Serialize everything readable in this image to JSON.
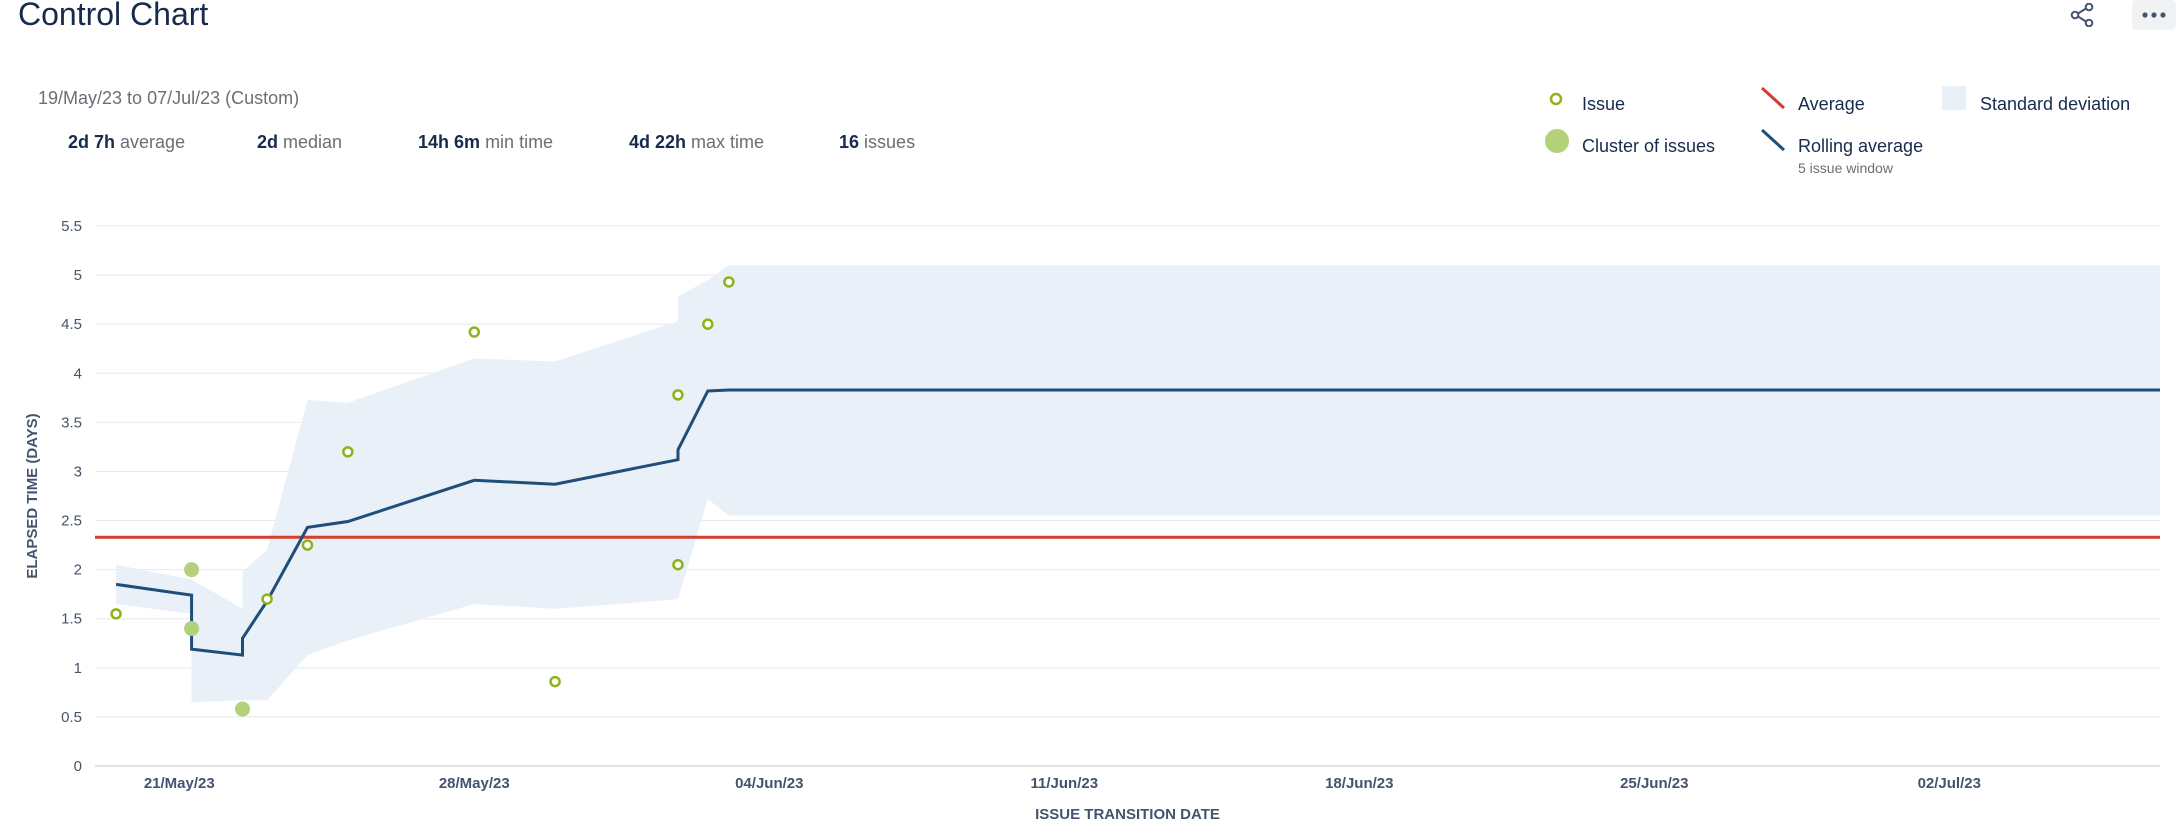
{
  "header": {
    "title": "Control Chart"
  },
  "summary": {
    "date_range": "19/May/23 to 07/Jul/23 (Custom)",
    "stats": [
      {
        "value": "2d 7h",
        "label": "average"
      },
      {
        "value": "2d",
        "label": "median"
      },
      {
        "value": "14h 6m",
        "label": "min time"
      },
      {
        "value": "4d 22h",
        "label": "max time"
      },
      {
        "value": "16",
        "label": "issues"
      }
    ]
  },
  "legend": {
    "issue": "Issue",
    "cluster": "Cluster of issues",
    "average": "Average",
    "rolling": "Rolling average",
    "rolling_sub": "5 issue window",
    "stddev": "Standard deviation"
  },
  "colors": {
    "issue": "#8fb21a",
    "cluster": "#b3d07a",
    "average": "#d53d30",
    "rolling": "#1f4e79",
    "stddev": "#e9f0f8",
    "grid": "#e6e8ec"
  },
  "icons": {
    "share": "share-icon",
    "more": "more-icon"
  },
  "chart_data": {
    "type": "scatter",
    "xlabel": "ISSUE TRANSITION DATE",
    "ylabel": "ELAPSED TIME (DAYS)",
    "ylim": [
      0,
      5.5
    ],
    "yticks": [
      "0",
      "0.5",
      "1",
      "1.5",
      "2",
      "2.5",
      "3",
      "3.5",
      "4",
      "4.5",
      "5",
      "5.5"
    ],
    "xlim": [
      "2023-05-19T00:00",
      "2023-07-07T00:00"
    ],
    "xticks": [
      {
        "date": "2023-05-21",
        "label": "21/May/23"
      },
      {
        "date": "2023-05-28",
        "label": "28/May/23"
      },
      {
        "date": "2023-06-04",
        "label": "04/Jun/23"
      },
      {
        "date": "2023-06-11",
        "label": "11/Jun/23"
      },
      {
        "date": "2023-06-18",
        "label": "18/Jun/23"
      },
      {
        "date": "2023-06-25",
        "label": "25/Jun/23"
      },
      {
        "date": "2023-07-02",
        "label": "02/Jul/23"
      }
    ],
    "average": 2.33,
    "issues": [
      {
        "x": "2023-05-19T12:00",
        "y": 1.55
      },
      {
        "x": "2023-05-23T02:00",
        "y": 1.7
      },
      {
        "x": "2023-05-24T01:00",
        "y": 2.25
      },
      {
        "x": "2023-05-25T00:00",
        "y": 3.2
      },
      {
        "x": "2023-05-28T00:00",
        "y": 4.42
      },
      {
        "x": "2023-05-29T22:00",
        "y": 0.86
      },
      {
        "x": "2023-06-01T20:00",
        "y": 2.05
      },
      {
        "x": "2023-06-01T20:00",
        "y": 3.78
      },
      {
        "x": "2023-06-02T13:00",
        "y": 4.5
      },
      {
        "x": "2023-06-03T01:00",
        "y": 4.93
      }
    ],
    "clusters": [
      {
        "x": "2023-05-21T07:00",
        "y": 2.0
      },
      {
        "x": "2023-05-21T07:00",
        "y": 1.4
      },
      {
        "x": "2023-05-22T12:00",
        "y": 0.58
      }
    ],
    "rolling_average": [
      {
        "x": "2023-05-19T12:00",
        "y": 1.85
      },
      {
        "x": "2023-05-21T07:00",
        "y": 1.74
      },
      {
        "x": "2023-05-21T07:00",
        "y": 1.19
      },
      {
        "x": "2023-05-22T12:00",
        "y": 1.13
      },
      {
        "x": "2023-05-22T12:00",
        "y": 1.3
      },
      {
        "x": "2023-05-23T02:00",
        "y": 1.68
      },
      {
        "x": "2023-05-24T01:00",
        "y": 2.43
      },
      {
        "x": "2023-05-25T00:00",
        "y": 2.49
      },
      {
        "x": "2023-05-28T00:00",
        "y": 2.91
      },
      {
        "x": "2023-05-29T22:00",
        "y": 2.87
      },
      {
        "x": "2023-06-01T20:00",
        "y": 3.12
      },
      {
        "x": "2023-06-01T20:00",
        "y": 3.22
      },
      {
        "x": "2023-06-02T13:00",
        "y": 3.82
      },
      {
        "x": "2023-06-03T01:00",
        "y": 3.83
      },
      {
        "x": "2023-07-07T00:00",
        "y": 3.83
      }
    ],
    "std_upper": [
      {
        "x": "2023-05-19T12:00",
        "y": 2.05
      },
      {
        "x": "2023-05-21T07:00",
        "y": 1.9
      },
      {
        "x": "2023-05-22T12:00",
        "y": 1.6
      },
      {
        "x": "2023-05-22T12:00",
        "y": 1.98
      },
      {
        "x": "2023-05-23T02:00",
        "y": 2.2
      },
      {
        "x": "2023-05-24T01:00",
        "y": 3.73
      },
      {
        "x": "2023-05-25T00:00",
        "y": 3.7
      },
      {
        "x": "2023-05-28T00:00",
        "y": 4.15
      },
      {
        "x": "2023-05-29T22:00",
        "y": 4.12
      },
      {
        "x": "2023-06-01T20:00",
        "y": 4.53
      },
      {
        "x": "2023-06-01T20:00",
        "y": 4.78
      },
      {
        "x": "2023-06-02T13:00",
        "y": 4.95
      },
      {
        "x": "2023-06-03T01:00",
        "y": 5.1
      },
      {
        "x": "2023-07-07T00:00",
        "y": 5.1
      }
    ],
    "std_lower": [
      {
        "x": "2023-05-19T12:00",
        "y": 1.65
      },
      {
        "x": "2023-05-21T07:00",
        "y": 1.55
      },
      {
        "x": "2023-05-21T07:00",
        "y": 0.65
      },
      {
        "x": "2023-05-22T12:00",
        "y": 0.67
      },
      {
        "x": "2023-05-23T02:00",
        "y": 0.67
      },
      {
        "x": "2023-05-24T01:00",
        "y": 1.13
      },
      {
        "x": "2023-05-25T00:00",
        "y": 1.28
      },
      {
        "x": "2023-05-28T00:00",
        "y": 1.65
      },
      {
        "x": "2023-05-29T22:00",
        "y": 1.6
      },
      {
        "x": "2023-06-01T20:00",
        "y": 1.7
      },
      {
        "x": "2023-06-02T13:00",
        "y": 2.72
      },
      {
        "x": "2023-06-03T01:00",
        "y": 2.55
      },
      {
        "x": "2023-07-07T00:00",
        "y": 2.55
      }
    ]
  }
}
